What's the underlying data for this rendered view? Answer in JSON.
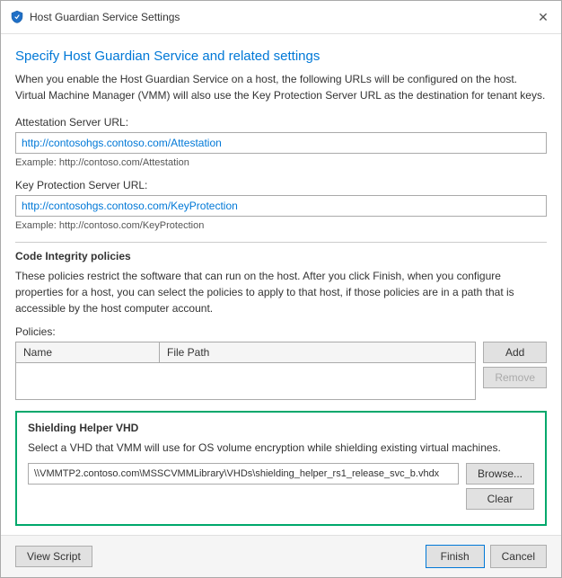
{
  "titleBar": {
    "icon": "shield",
    "title": "Host Guardian Service Settings",
    "closeLabel": "✕"
  },
  "pageTitle": "Specify Host Guardian Service and related settings",
  "description": "When you enable the Host Guardian Service on a host, the following URLs will be configured on the host. Virtual Machine Manager (VMM) will also use the Key Protection Server URL as the destination for tenant keys.",
  "attestationSection": {
    "label": "Attestation Server URL:",
    "value": "http://contosohgs.contoso.com/Attestation",
    "example": "Example: http://contoso.com/Attestation"
  },
  "keyProtectionSection": {
    "label": "Key Protection Server URL:",
    "value": "http://contosohgs.contoso.com/KeyProtection",
    "example": "Example: http://contoso.com/KeyProtection"
  },
  "codeIntegritySection": {
    "title": "Code Integrity policies",
    "description": "These policies restrict the software that can run on the host. After you click Finish, when you configure properties for a host, you can select the policies to apply to that host, if those policies are in a path that is accessible by the host computer account.",
    "policiesLabel": "Policies:",
    "tableHeaders": [
      "Name",
      "File Path"
    ],
    "addButton": "Add",
    "removeButton": "Remove"
  },
  "shieldingSection": {
    "title": "Shielding Helper VHD",
    "description": "Select a VHD that VMM will use for OS volume encryption while shielding existing virtual machines.",
    "vhdPath": "\\\\VMMTP2.contoso.com\\MSSCVMMLibrary\\VHDs\\shielding_helper_rs1_release_svc_b.vhdx",
    "browseButton": "Browse...",
    "clearButton": "Clear"
  },
  "footer": {
    "viewScriptButton": "View Script",
    "finishButton": "Finish",
    "cancelButton": "Cancel"
  }
}
